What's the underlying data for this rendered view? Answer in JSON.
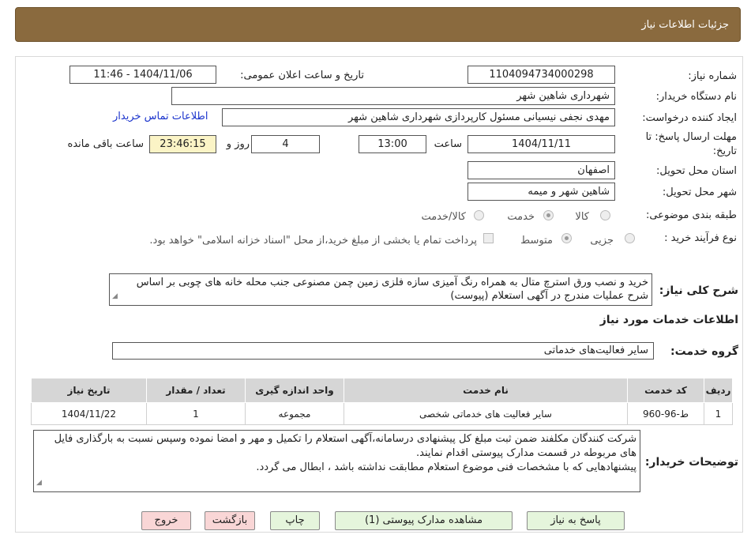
{
  "header": {
    "title": "جزئیات اطلاعات نیاز"
  },
  "form": {
    "need_number": {
      "label": "شماره نیاز:",
      "value": "1104094734000298"
    },
    "announce_datetime": {
      "label": "تاریخ و ساعت اعلان عمومی:",
      "value": "1404/11/06 - 11:46"
    },
    "buyer_org": {
      "label": "نام دستگاه خریدار:",
      "value": "شهرداری شاهین شهر"
    },
    "requester": {
      "label": "ایجاد کننده درخواست:",
      "value": "مهدی نجفی نیسیانی مسئول کارپردازی شهرداری شاهین شهر",
      "contact_link": "اطلاعات تماس خریدار"
    },
    "deadline": {
      "label_line1": "مهلت ارسال پاسخ: تا",
      "label_line2": "تاریخ:",
      "date": "1404/11/11",
      "time_label": "ساعت",
      "time": "13:00",
      "days": "4",
      "days_label": "روز و",
      "remaining": "23:46:15",
      "remaining_label": "ساعت باقی مانده"
    },
    "province": {
      "label": "استان محل تحویل:",
      "value": "اصفهان"
    },
    "city": {
      "label": "شهر محل تحویل:",
      "value": "شاهین شهر و میمه"
    },
    "category": {
      "label": "طبقه بندی موضوعی:",
      "options": [
        "کالا",
        "خدمت",
        "کالا/خدمت"
      ],
      "selected": "خدمت"
    },
    "process": {
      "label": "نوع فرآیند خرید :",
      "options": [
        "جزیی",
        "متوسط"
      ],
      "selected": "متوسط",
      "payment_note": "پرداخت تمام یا بخشی از مبلغ خرید،از محل \"اسناد خزانه اسلامی\" خواهد بود."
    },
    "description": {
      "label": "شرح کلی نیاز:",
      "value": "خرید و نصب ورق استرچ متال به همراه رنگ آمیزی سازه فلزی زمین چمن مصنوعی جنب محله خانه های چوبی بر اساس شرح عملیات مندرج در آگهی استعلام (پیوست)"
    }
  },
  "services": {
    "section_title": "اطلاعات خدمات مورد نیاز",
    "group_label": "گروه خدمت:",
    "group_value": "سایر فعالیت‌های خدماتی",
    "table": {
      "headers": [
        "ردیف",
        "کد خدمت",
        "نام خدمت",
        "واحد اندازه گیری",
        "تعداد / مقدار",
        "تاریخ نیاز"
      ],
      "rows": [
        [
          "1",
          "ط-96-960",
          "سایر فعالیت های خدماتی شخصی",
          "مجموعه",
          "1",
          "1404/11/22"
        ]
      ]
    }
  },
  "buyer_notes": {
    "label": "توضیحات خریدار:",
    "lines": [
      "شرکت کنندگان مکلفند ضمن ثبت مبلغ کل پیشنهادی درسامانه،آگهی استعلام را  تکمیل و مهر و امضا نموده وسپس نسبت به بارگذاری فایل های مربوطه در قسمت مدارک پیوستی اقدام نمایند.",
      "پیشنهادهایی که با مشخصات فنی موضوع استعلام مطابقت نداشته باشد ، ابطال می گردد."
    ]
  },
  "buttons": {
    "reply": "پاسخ به نیاز",
    "attachments": "مشاهده مدارک پیوستی (1)",
    "print": "چاپ",
    "back": "بازگشت",
    "exit": "خروج"
  },
  "colors": {
    "header": "#8a6a3e",
    "remaining_bg": "#fbf4c6",
    "link": "#1a33cc",
    "green_button": "#e5f5dc",
    "pink_button": "#f9d6d6"
  }
}
